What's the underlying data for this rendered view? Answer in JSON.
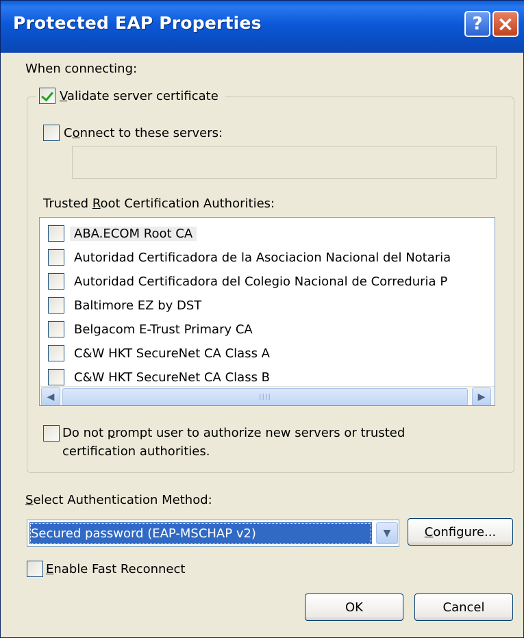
{
  "window": {
    "title": "Protected EAP Properties",
    "help_glyph": "?",
    "close_glyph": "×"
  },
  "when_connecting_label": "When connecting:",
  "validate": {
    "checked": true,
    "label_pre": "",
    "label_accel": "V",
    "label_post": "alidate server certificate"
  },
  "connect": {
    "checked": false,
    "label_pre": "C",
    "label_accel": "o",
    "label_post": "nnect to these servers:",
    "servers_value": ""
  },
  "trusted_root": {
    "label_pre": "Trusted ",
    "label_accel": "R",
    "label_post": "oot Certification Authorities:",
    "items": [
      {
        "label": "ABA.ECOM Root CA",
        "checked": false
      },
      {
        "label": "Autoridad Certificadora de la Asociacion Nacional del Notaria",
        "checked": false
      },
      {
        "label": "Autoridad Certificadora del Colegio Nacional de Correduria P",
        "checked": false
      },
      {
        "label": "Baltimore EZ by DST",
        "checked": false
      },
      {
        "label": "Belgacom E-Trust Primary CA",
        "checked": false
      },
      {
        "label": "C&W HKT SecureNet CA Class A",
        "checked": false
      },
      {
        "label": "C&W HKT SecureNet CA Class B",
        "checked": false
      }
    ]
  },
  "scroll": {
    "up": "▲",
    "down": "▼",
    "left": "◀",
    "right": "▶",
    "grip": "IIII"
  },
  "do_not_prompt": {
    "checked": false,
    "line1_pre": "Do not ",
    "line1_accel": "p",
    "line1_post": "rompt user to authorize new servers or trusted",
    "line2": "certification authorities."
  },
  "auth_method": {
    "label_accel": "S",
    "label_post": "elect Authentication Method:",
    "selected": "Secured password (EAP-MSCHAP v2)",
    "arrow": "▼"
  },
  "configure_button": {
    "accel": "C",
    "rest": "onfigure..."
  },
  "fast_reconnect": {
    "checked": false,
    "label_accel": "E",
    "label_post": "nable Fast Reconnect"
  },
  "ok_button": "OK",
  "cancel_button": "Cancel"
}
